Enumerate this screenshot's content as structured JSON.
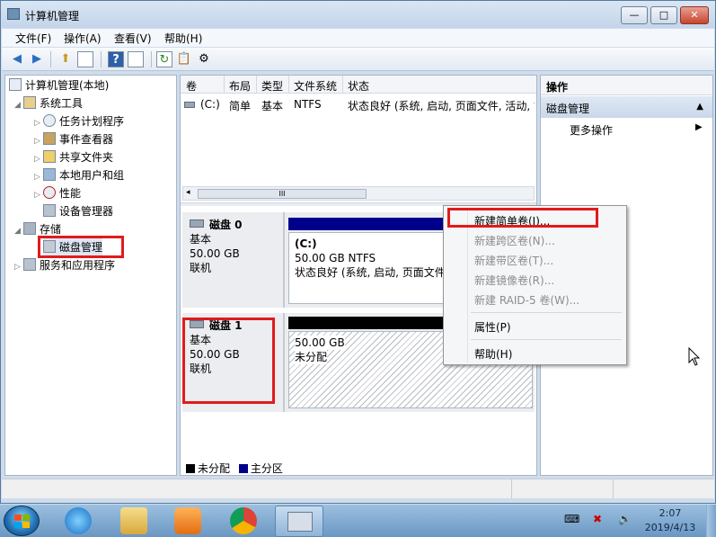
{
  "window": {
    "title": "计算机管理",
    "min_label": "—",
    "max_label": "□",
    "close_label": "✕"
  },
  "menubar": {
    "items": [
      "文件(F)",
      "操作(A)",
      "查看(V)",
      "帮助(H)"
    ]
  },
  "tree": {
    "root": "计算机管理(本地)",
    "system_tools": "系统工具",
    "task_scheduler": "任务计划程序",
    "event_viewer": "事件查看器",
    "shared_folders": "共享文件夹",
    "local_users": "本地用户和组",
    "performance": "性能",
    "device_manager": "设备管理器",
    "storage": "存储",
    "disk_management": "磁盘管理",
    "services_apps": "服务和应用程序"
  },
  "volume_list": {
    "headers": [
      "卷",
      "布局",
      "类型",
      "文件系统",
      "状态"
    ],
    "rows": [
      {
        "volume": "(C:)",
        "layout": "简单",
        "type": "基本",
        "fs": "NTFS",
        "status": "状态良好 (系统, 启动, 页面文件, 活动, 故"
      }
    ],
    "scroll_thumb": "III"
  },
  "disks": [
    {
      "name": "磁盘 0",
      "kind": "基本",
      "size": "50.00 GB",
      "state": "联机",
      "partition": {
        "label": "(C:)",
        "size_fs": "50.00 GB NTFS",
        "status": "状态良好 (系统, 启动, 页面文件"
      }
    },
    {
      "name": "磁盘 1",
      "kind": "基本",
      "size": "50.00 GB",
      "state": "联机",
      "partition": {
        "size": "50.00 GB",
        "status": "未分配"
      }
    }
  ],
  "legend": {
    "unallocated": "未分配",
    "primary": "主分区",
    "unallocated_color": "#000000",
    "primary_color": "#00008b"
  },
  "actions": {
    "header": "操作",
    "section": "磁盘管理",
    "more": "更多操作"
  },
  "context_menu": {
    "new_simple": "新建简单卷(I)...",
    "new_spanned": "新建跨区卷(N)...",
    "new_striped": "新建带区卷(T)...",
    "new_mirrored": "新建镜像卷(R)...",
    "new_raid5": "新建 RAID-5 卷(W)...",
    "properties": "属性(P)",
    "help": "帮助(H)"
  },
  "taskbar": {
    "time": "2:07",
    "date": "2019/4/13"
  },
  "colors": {
    "highlight_box": "#e11b1b",
    "primary_bar": "#00008b"
  }
}
